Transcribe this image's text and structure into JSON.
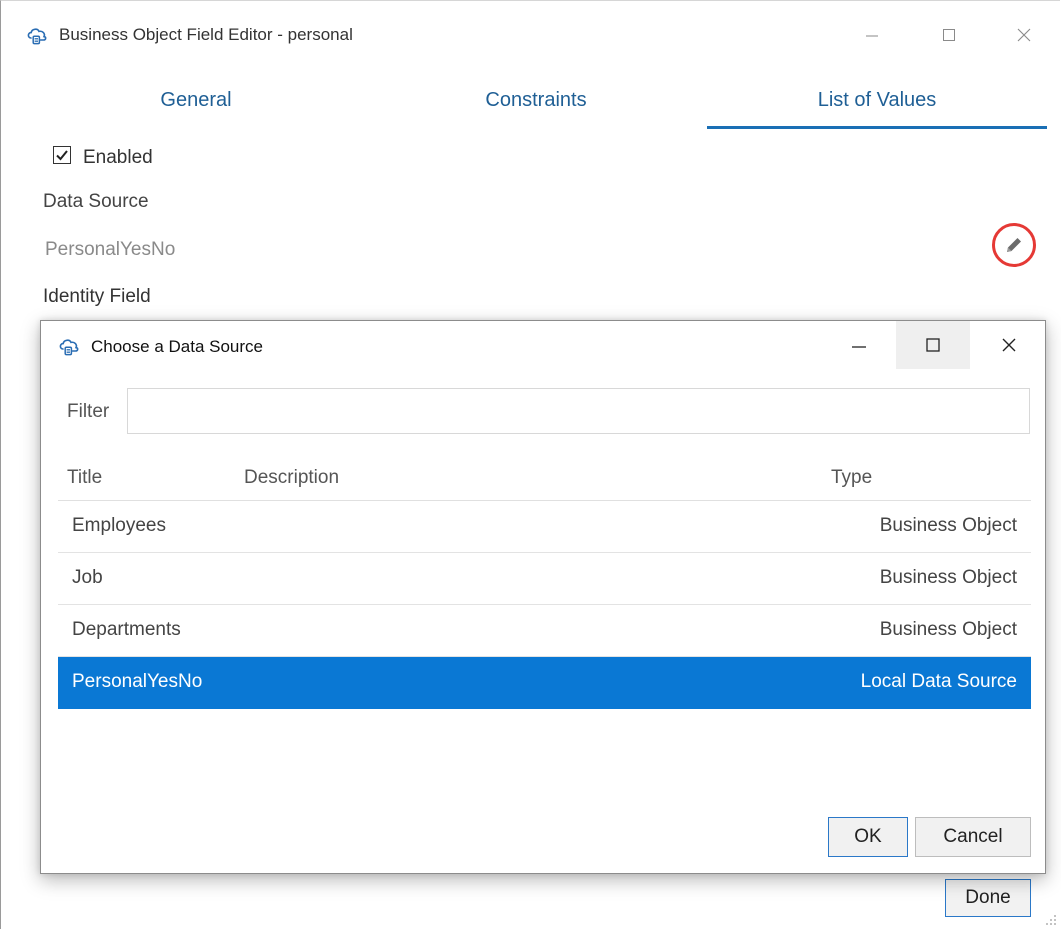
{
  "main_window": {
    "title": "Business Object Field Editor - personal",
    "icon": "cloud-database-icon",
    "controls": {
      "minimize": "minimize-icon",
      "maximize": "maximize-icon",
      "close": "close-icon"
    }
  },
  "tabs": [
    {
      "label": "General",
      "active": false
    },
    {
      "label": "Constraints",
      "active": false
    },
    {
      "label": "List of Values",
      "active": true
    }
  ],
  "list_of_values": {
    "enabled_label": "Enabled",
    "enabled_checked": true,
    "data_source_label": "Data Source",
    "data_source_value": "PersonalYesNo",
    "identity_field_label": "Identity Field",
    "edit_icon": "pencil-icon",
    "highlight_color": "#e53935"
  },
  "footer": {
    "done_label": "Done"
  },
  "dialog": {
    "title": "Choose a Data Source",
    "icon": "cloud-database-icon",
    "filter_label": "Filter",
    "filter_value": "",
    "columns": {
      "title": "Title",
      "description": "Description",
      "type": "Type"
    },
    "rows": [
      {
        "title": "Employees",
        "description": "",
        "type": "Business Object",
        "selected": false
      },
      {
        "title": "Job",
        "description": "",
        "type": "Business Object",
        "selected": false
      },
      {
        "title": "Departments",
        "description": "",
        "type": "Business Object",
        "selected": false
      },
      {
        "title": "PersonalYesNo",
        "description": "",
        "type": "Local Data Source",
        "selected": true
      }
    ],
    "ok_label": "OK",
    "cancel_label": "Cancel",
    "selection_color": "#0a78d4"
  },
  "colors": {
    "accent": "#1a6fb5",
    "tab_text": "#1f5f95"
  }
}
